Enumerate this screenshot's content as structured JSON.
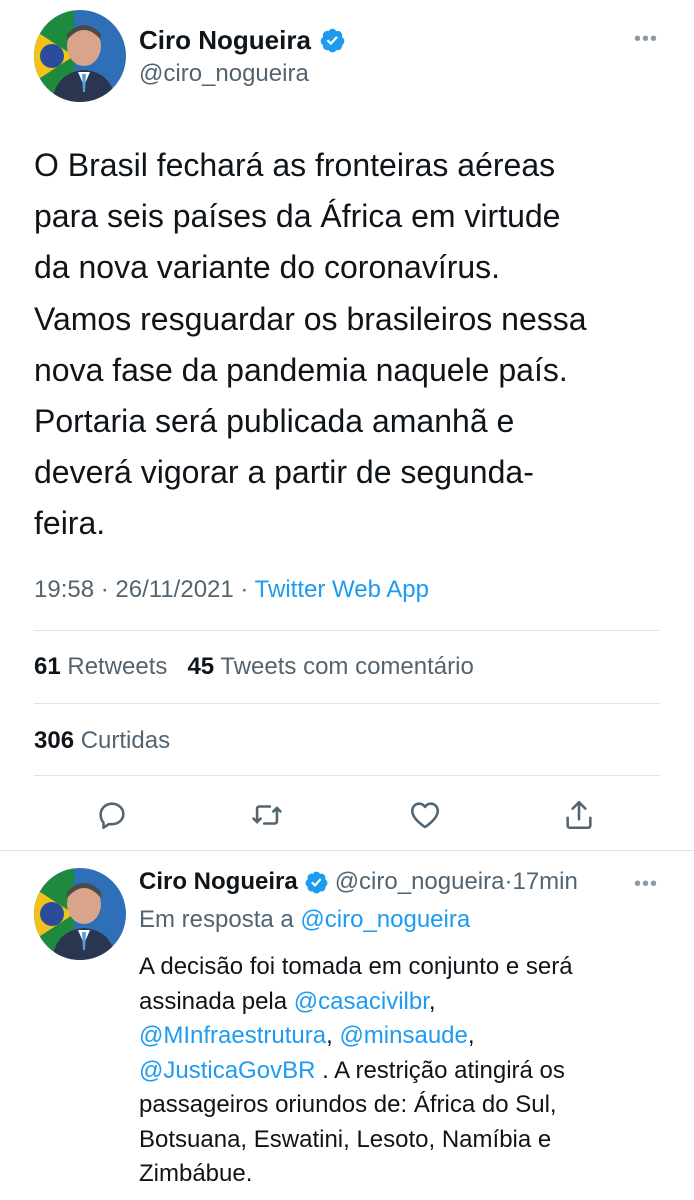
{
  "main_tweet": {
    "author": {
      "display_name": "Ciro Nogueira",
      "handle": "@ciro_nogueira",
      "verified": true
    },
    "more_label": "•••",
    "text": "O Brasil fechará as fronteiras aéreas\npara seis países da África em virtude\nda nova variante do coronavírus.\nVamos resguardar os brasileiros nessa\nnova fase da pandemia naquele país.\nPortaria será publicada amanhã e\ndeverá vigorar a partir de segunda-\nfeira.",
    "time": "19:58",
    "date": "26/11/2021",
    "separator": "·",
    "source": "Twitter Web App",
    "stats": {
      "retweets_count": "61",
      "retweets_label": "Retweets",
      "quotes_count": "45",
      "quotes_label": "Tweets com comentário",
      "likes_count": "306",
      "likes_label": "Curtidas"
    },
    "actions": {
      "reply_icon": "reply-icon",
      "retweet_icon": "retweet-icon",
      "like_icon": "heart-icon",
      "share_icon": "share-icon"
    }
  },
  "reply_tweet": {
    "author": {
      "display_name": "Ciro Nogueira",
      "handle": "@ciro_nogueira",
      "verified": true
    },
    "separator": "·",
    "age": "17min",
    "more_label": "•••",
    "reply_prefix": "Em resposta a",
    "reply_mention": "@ciro_nogueira",
    "text_parts": {
      "line1": "A decisão foi tomada em conjunto e será",
      "line2_prefix": "assinada pela",
      "mention1": "@casacivilbr",
      "line2_suffix": ",",
      "mention2": "@MInfraestrutura",
      "line3_sep": ",",
      "mention3": "@minsaude",
      "line3_suffix": ",",
      "mention4": "@JusticaGovBR",
      "line4_suffix": " . A restrição atingirá os",
      "line5": "passageiros oriundos de:  África do Sul,",
      "line6": "Botsuana, Eswatini, Lesoto, Namíbia e",
      "line7": "Zimbábue."
    }
  },
  "colors": {
    "accent": "#1d9bf0",
    "text": "#0f1419",
    "secondary": "#536471",
    "divider": "#dfe3e6"
  }
}
